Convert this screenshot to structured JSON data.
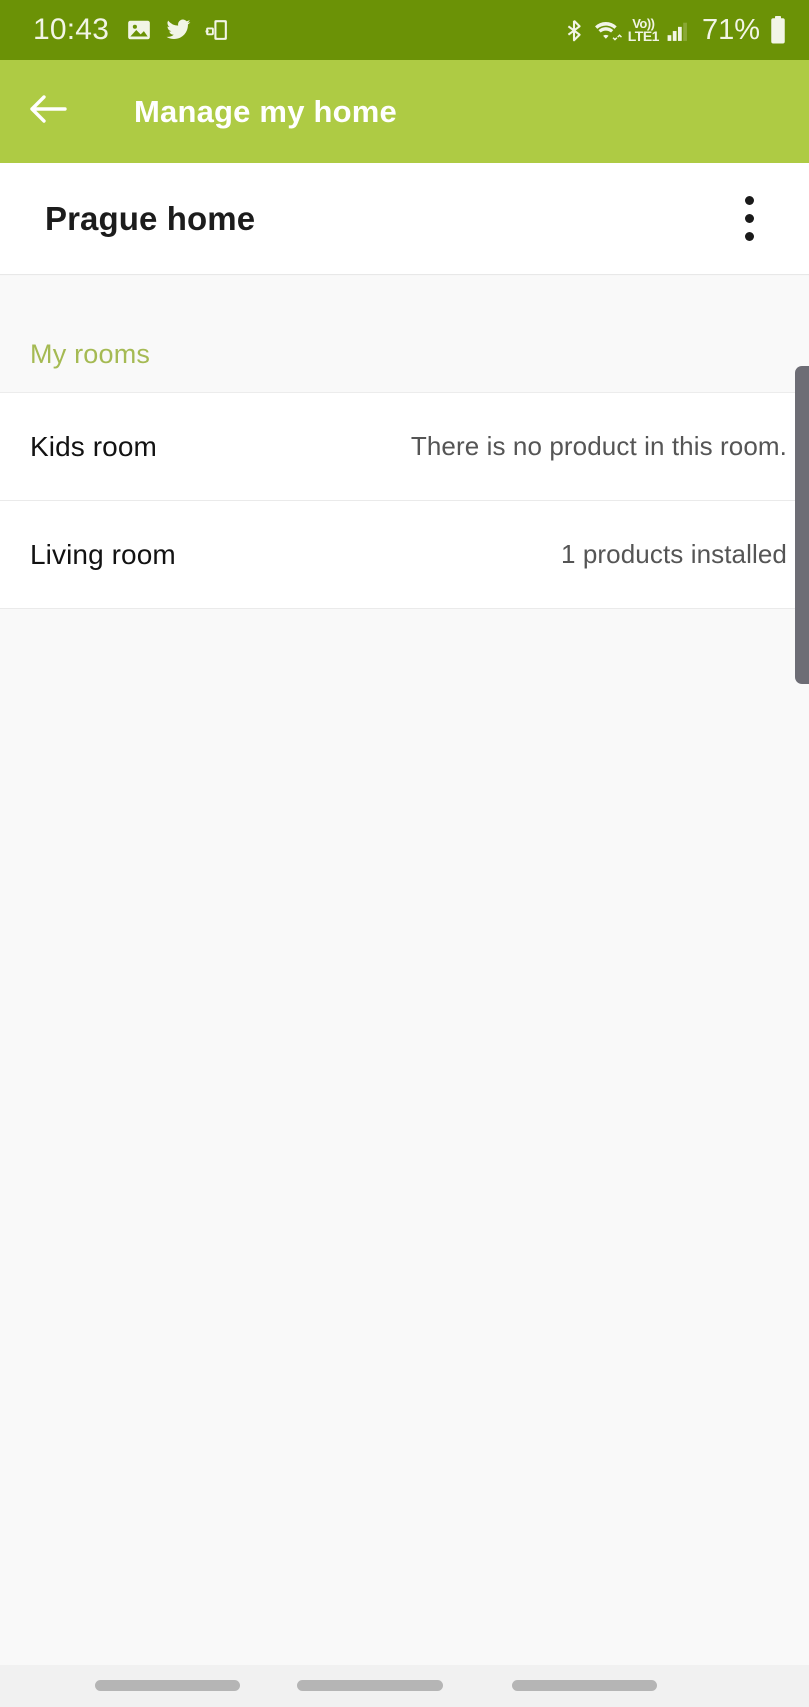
{
  "status_bar": {
    "background_color": "#6b9206",
    "clock": "10:43",
    "left_icons": [
      {
        "name": "gallery-image-icon"
      },
      {
        "name": "twitter-bird-icon"
      },
      {
        "name": "smart-view-cast-icon"
      }
    ],
    "right_icons": [
      {
        "name": "bluetooth-icon"
      },
      {
        "name": "wifi-icon"
      },
      {
        "name": "mobile-signal-icon"
      },
      {
        "name": "battery-icon"
      }
    ],
    "volte_label_top": "Vo))",
    "volte_label_bottom": "LTE1",
    "battery_percent": "71%"
  },
  "app_bar": {
    "background_color": "#aecb44",
    "title": "Manage my home",
    "back_icon": "arrow-left-icon"
  },
  "home": {
    "name": "Prague home",
    "overflow_icon": "more-vertical-icon"
  },
  "section": {
    "label": "My rooms",
    "label_color": "#a5ba53"
  },
  "rooms": [
    {
      "name": "Kids room",
      "status": "There is no product in this room."
    },
    {
      "name": "Living room",
      "status": "1 products installed"
    }
  ],
  "scrollbar": {
    "thumb_color": "#6d6d75"
  },
  "navigation_bar": {
    "background_color": "#f1f1f1",
    "buttons": [
      {
        "name": "recents-button"
      },
      {
        "name": "home-button"
      },
      {
        "name": "back-button"
      }
    ]
  }
}
